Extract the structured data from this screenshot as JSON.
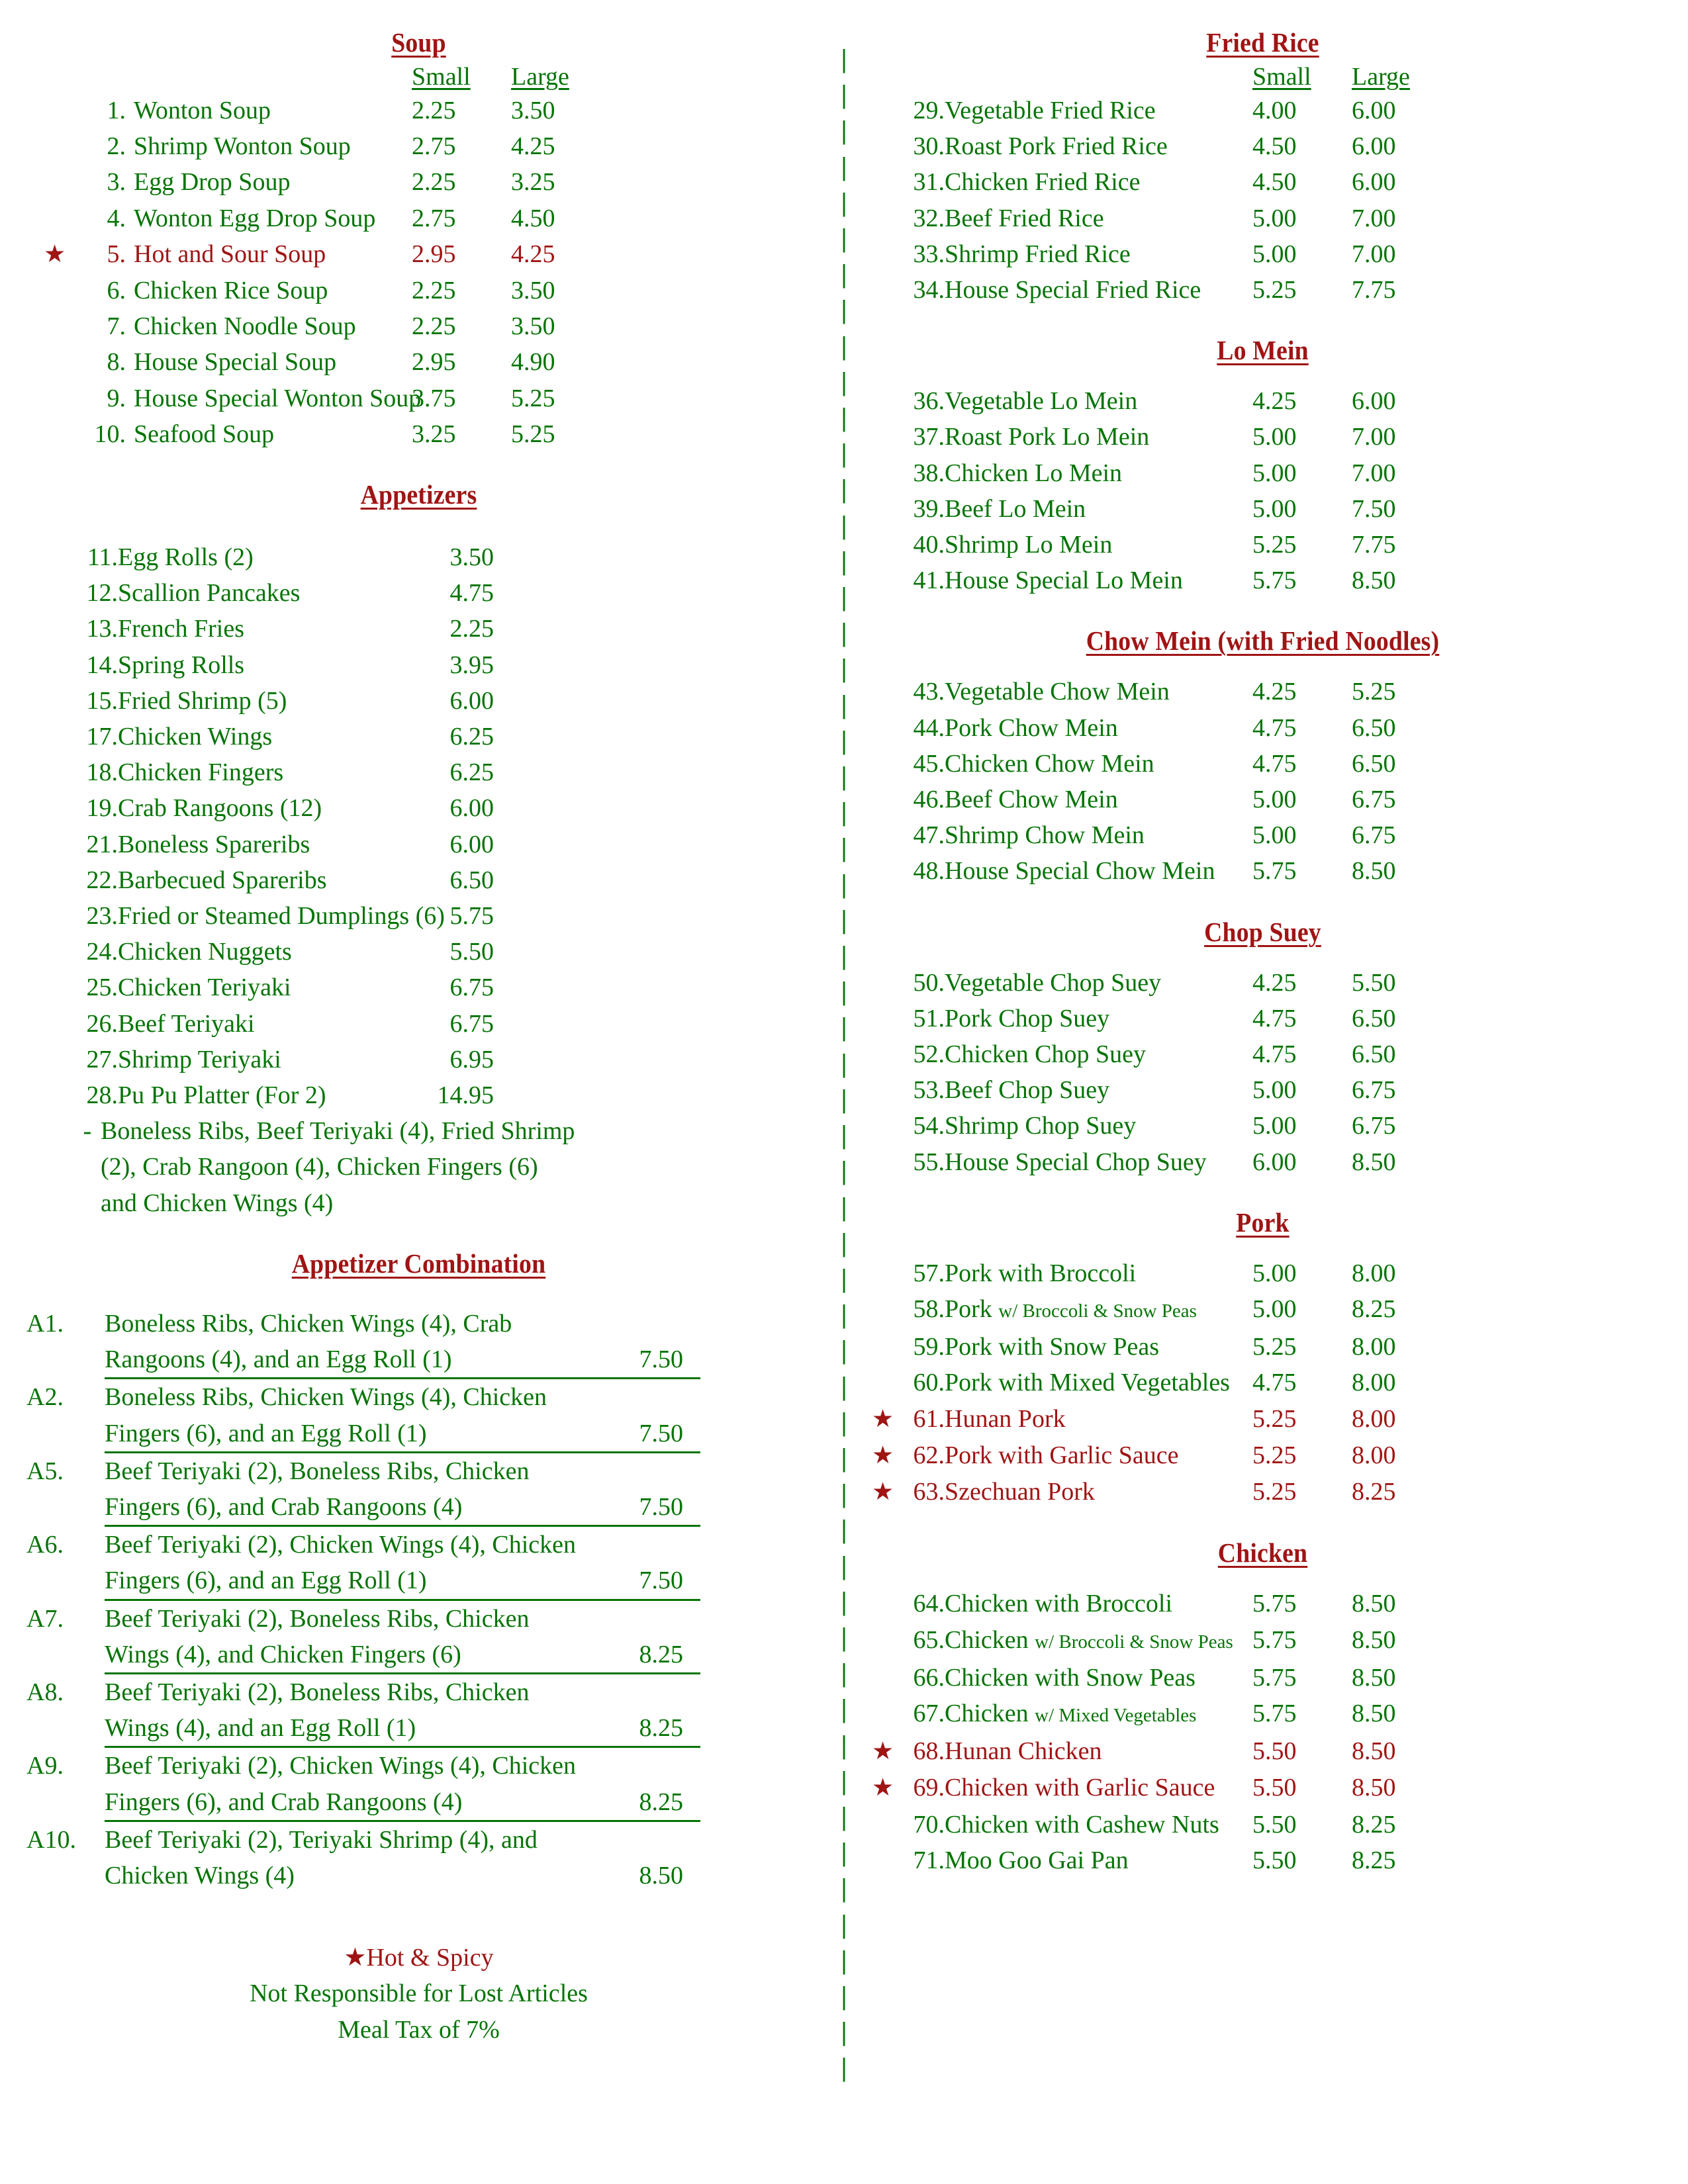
{
  "symbols": {
    "star": "★",
    "divider_glyph": "|",
    "dash": "-"
  },
  "colors": {
    "item_green": "#067406",
    "heading_red": "#A01414"
  },
  "size_labels": {
    "small": "Small",
    "large": "Large"
  },
  "left_column": {
    "soup": {
      "heading": "Soup",
      "items": [
        {
          "num": "1.",
          "name": "Wonton Soup",
          "small": "2.25",
          "large": "3.50",
          "hot": false
        },
        {
          "num": "2.",
          "name": "Shrimp Wonton Soup",
          "small": "2.75",
          "large": "4.25",
          "hot": false
        },
        {
          "num": "3.",
          "name": "Egg Drop Soup",
          "small": "2.25",
          "large": "3.25",
          "hot": false
        },
        {
          "num": "4.",
          "name": "Wonton Egg Drop Soup",
          "small": "2.75",
          "large": "4.50",
          "hot": false
        },
        {
          "num": "5.",
          "name": "Hot and Sour Soup",
          "small": "2.95",
          "large": "4.25",
          "hot": true
        },
        {
          "num": "6.",
          "name": "Chicken Rice Soup",
          "small": "2.25",
          "large": "3.50",
          "hot": false
        },
        {
          "num": "7.",
          "name": "Chicken Noodle Soup",
          "small": "2.25",
          "large": "3.50",
          "hot": false
        },
        {
          "num": "8.",
          "name": "House Special Soup",
          "small": "2.95",
          "large": "4.90",
          "hot": false
        },
        {
          "num": "9.",
          "name": "House Special Wonton Soup",
          "small": "3.75",
          "large": "5.25",
          "hot": false
        },
        {
          "num": "10.",
          "name": "Seafood Soup",
          "small": "3.25",
          "large": "5.25",
          "hot": false
        }
      ]
    },
    "appetizers": {
      "heading": "Appetizers",
      "items": [
        {
          "num": "11.",
          "name": "Egg Rolls (2)",
          "price": "3.50"
        },
        {
          "num": "12.",
          "name": "Scallion Pancakes",
          "price": "4.75"
        },
        {
          "num": "13.",
          "name": "French Fries",
          "price": "2.25"
        },
        {
          "num": "14.",
          "name": "Spring Rolls",
          "price": "3.95"
        },
        {
          "num": "15.",
          "name": "Fried Shrimp (5)",
          "price": "6.00"
        },
        {
          "num": "17.",
          "name": "Chicken Wings",
          "price": "6.25"
        },
        {
          "num": "18.",
          "name": "Chicken Fingers",
          "price": "6.25"
        },
        {
          "num": "19.",
          "name": "Crab Rangoons (12)",
          "price": "6.00"
        },
        {
          "num": "21.",
          "name": "Boneless Spareribs",
          "price": "6.00"
        },
        {
          "num": "22.",
          "name": "Barbecued Spareribs",
          "price": "6.50"
        },
        {
          "num": "23.",
          "name": "Fried or Steamed Dumplings (6)",
          "price": "5.75"
        },
        {
          "num": "24.",
          "name": "Chicken Nuggets",
          "price": "5.50"
        },
        {
          "num": "25.",
          "name": "Chicken Teriyaki",
          "price": "6.75"
        },
        {
          "num": "26.",
          "name": "Beef Teriyaki",
          "price": "6.75"
        },
        {
          "num": "27.",
          "name": "Shrimp Teriyaki",
          "price": "6.95"
        },
        {
          "num": "28.",
          "name": "Pu Pu Platter (For 2)",
          "price": "14.95"
        }
      ],
      "pu_pu_description": [
        "Boneless Ribs, Beef Teriyaki (4), Fried Shrimp",
        "(2), Crab Rangoon (4), Chicken Fingers (6)",
        "and Chicken Wings (4)"
      ]
    },
    "appetizer_combination": {
      "heading": "Appetizer Combination",
      "items": [
        {
          "code": "A1.",
          "line1": "Boneless Ribs, Chicken Wings (4), Crab",
          "line2": "Rangoons (4), and an Egg Roll (1)",
          "price": "7.50",
          "underline": true
        },
        {
          "code": "A2.",
          "line1": "Boneless Ribs, Chicken Wings (4), Chicken",
          "line2": "Fingers (6), and an Egg Roll (1)",
          "price": "7.50",
          "underline": true
        },
        {
          "code": "A5.",
          "line1": "Beef Teriyaki (2), Boneless Ribs, Chicken",
          "line2": "Fingers (6), and Crab Rangoons (4)",
          "price": "7.50",
          "underline": true
        },
        {
          "code": "A6.",
          "line1": "Beef Teriyaki (2), Chicken Wings (4), Chicken",
          "line2": "Fingers (6), and an Egg Roll (1)",
          "price": "7.50",
          "underline": true
        },
        {
          "code": "A7.",
          "line1": "Beef Teriyaki (2), Boneless Ribs, Chicken",
          "line2": "Wings (4), and Chicken Fingers (6)",
          "price": "8.25",
          "underline": true
        },
        {
          "code": "A8.",
          "line1": "Beef Teriyaki (2), Boneless Ribs, Chicken",
          "line2": "Wings (4), and an Egg Roll (1)",
          "price": "8.25",
          "underline": true
        },
        {
          "code": "A9.",
          "line1": "Beef Teriyaki (2), Chicken Wings (4), Chicken",
          "line2": "Fingers (6), and Crab Rangoons (4)",
          "price": "8.25",
          "underline": true
        },
        {
          "code": "A10.",
          "line1": "Beef Teriyaki (2), Teriyaki Shrimp (4), and",
          "line2": "Chicken Wings (4)",
          "price": "8.50",
          "underline": false
        }
      ]
    },
    "notes": {
      "hot_spicy": "Hot & Spicy",
      "lost_articles": "Not Responsible for Lost Articles",
      "meal_tax": "Meal Tax of 7%"
    }
  },
  "right_column": {
    "fried_rice": {
      "heading": "Fried Rice",
      "items": [
        {
          "num": "29.",
          "name": "Vegetable Fried Rice",
          "small": "4.00",
          "large": "6.00",
          "hot": false
        },
        {
          "num": "30.",
          "name": "Roast Pork Fried Rice",
          "small": "4.50",
          "large": "6.00",
          "hot": false
        },
        {
          "num": "31.",
          "name": "Chicken Fried Rice",
          "small": "4.50",
          "large": "6.00",
          "hot": false
        },
        {
          "num": "32.",
          "name": "Beef Fried Rice",
          "small": "5.00",
          "large": "7.00",
          "hot": false
        },
        {
          "num": "33.",
          "name": "Shrimp Fried Rice",
          "small": "5.00",
          "large": "7.00",
          "hot": false
        },
        {
          "num": "34.",
          "name": "House Special Fried Rice",
          "small": "5.25",
          "large": "7.75",
          "hot": false
        }
      ]
    },
    "lo_mein": {
      "heading": "Lo Mein",
      "items": [
        {
          "num": "36.",
          "name": "Vegetable Lo Mein",
          "small": "4.25",
          "large": "6.00",
          "hot": false
        },
        {
          "num": "37.",
          "name": "Roast Pork Lo Mein",
          "small": "5.00",
          "large": "7.00",
          "hot": false
        },
        {
          "num": "38.",
          "name": "Chicken Lo Mein",
          "small": "5.00",
          "large": "7.00",
          "hot": false
        },
        {
          "num": "39.",
          "name": "Beef Lo Mein",
          "small": "5.00",
          "large": "7.50",
          "hot": false
        },
        {
          "num": "40.",
          "name": "Shrimp Lo Mein",
          "small": "5.25",
          "large": "7.75",
          "hot": false
        },
        {
          "num": "41.",
          "name": "House Special Lo Mein",
          "small": "5.75",
          "large": "8.50",
          "hot": false
        }
      ]
    },
    "chow_mein": {
      "heading": "Chow Mein (with Fried Noodles)",
      "items": [
        {
          "num": "43.",
          "name": "Vegetable Chow Mein",
          "small": "4.25",
          "large": "5.25",
          "hot": false
        },
        {
          "num": "44.",
          "name": "Pork Chow Mein",
          "small": "4.75",
          "large": "6.50",
          "hot": false
        },
        {
          "num": "45.",
          "name": "Chicken Chow Mein",
          "small": "4.75",
          "large": "6.50",
          "hot": false
        },
        {
          "num": "46.",
          "name": "Beef Chow Mein",
          "small": "5.00",
          "large": "6.75",
          "hot": false
        },
        {
          "num": "47.",
          "name": "Shrimp Chow Mein",
          "small": "5.00",
          "large": "6.75",
          "hot": false
        },
        {
          "num": "48.",
          "name": "House Special Chow Mein",
          "small": "5.75",
          "large": "8.50",
          "hot": false
        }
      ]
    },
    "chop_suey": {
      "heading": "Chop Suey",
      "items": [
        {
          "num": "50.",
          "name": "Vegetable Chop Suey",
          "small": "4.25",
          "large": "5.50",
          "hot": false
        },
        {
          "num": "51.",
          "name": "Pork Chop Suey",
          "small": "4.75",
          "large": "6.50",
          "hot": false
        },
        {
          "num": "52.",
          "name": "Chicken Chop Suey",
          "small": "4.75",
          "large": "6.50",
          "hot": false
        },
        {
          "num": "53.",
          "name": "Beef Chop Suey",
          "small": "5.00",
          "large": "6.75",
          "hot": false
        },
        {
          "num": "54.",
          "name": "Shrimp Chop Suey",
          "small": "5.00",
          "large": "6.75",
          "hot": false
        },
        {
          "num": "55.",
          "name": "House Special Chop Suey",
          "small": "6.00",
          "large": "8.50",
          "hot": false
        }
      ]
    },
    "pork": {
      "heading": "Pork",
      "items": [
        {
          "num": "57.",
          "name": "Pork with Broccoli",
          "sub": "",
          "small": "5.00",
          "large": "8.00",
          "hot": false
        },
        {
          "num": "58.",
          "name": "Pork ",
          "sub": "w/ Broccoli & Snow Peas",
          "small": "5.00",
          "large": "8.25",
          "hot": false
        },
        {
          "num": "59.",
          "name": "Pork with Snow Peas",
          "sub": "",
          "small": "5.25",
          "large": "8.00",
          "hot": false
        },
        {
          "num": "60.",
          "name": "Pork with Mixed Vegetables",
          "sub": "",
          "small": "4.75",
          "large": "8.00",
          "hot": false
        },
        {
          "num": "61.",
          "name": "Hunan Pork",
          "sub": "",
          "small": "5.25",
          "large": "8.00",
          "hot": true
        },
        {
          "num": "62.",
          "name": "Pork with Garlic Sauce",
          "sub": "",
          "small": "5.25",
          "large": "8.00",
          "hot": true
        },
        {
          "num": "63.",
          "name": "Szechuan Pork",
          "sub": "",
          "small": "5.25",
          "large": "8.25",
          "hot": true
        }
      ]
    },
    "chicken": {
      "heading": "Chicken",
      "items": [
        {
          "num": "64.",
          "name": "Chicken with Broccoli",
          "sub": "",
          "small": "5.75",
          "large": "8.50",
          "hot": false
        },
        {
          "num": "65.",
          "name": "Chicken ",
          "sub": "w/ Broccoli & Snow Peas",
          "small": "5.75",
          "large": "8.50",
          "hot": false
        },
        {
          "num": "66.",
          "name": "Chicken with Snow Peas",
          "sub": "",
          "small": "5.75",
          "large": "8.50",
          "hot": false
        },
        {
          "num": "67.",
          "name": "Chicken ",
          "sub": "w/ Mixed Vegetables",
          "small": "5.75",
          "large": "8.50",
          "hot": false
        },
        {
          "num": "68.",
          "name": "Hunan Chicken",
          "sub": "",
          "small": "5.50",
          "large": "8.50",
          "hot": true
        },
        {
          "num": "69.",
          "name": "Chicken with Garlic Sauce",
          "sub": "",
          "small": "5.50",
          "large": "8.50",
          "hot": true
        },
        {
          "num": "70.",
          "name": "Chicken with Cashew Nuts",
          "sub": "",
          "small": "5.50",
          "large": "8.25",
          "hot": false
        },
        {
          "num": "71.",
          "name": "Moo Goo Gai Pan",
          "sub": "",
          "small": "5.50",
          "large": "8.25",
          "hot": false
        }
      ]
    }
  }
}
